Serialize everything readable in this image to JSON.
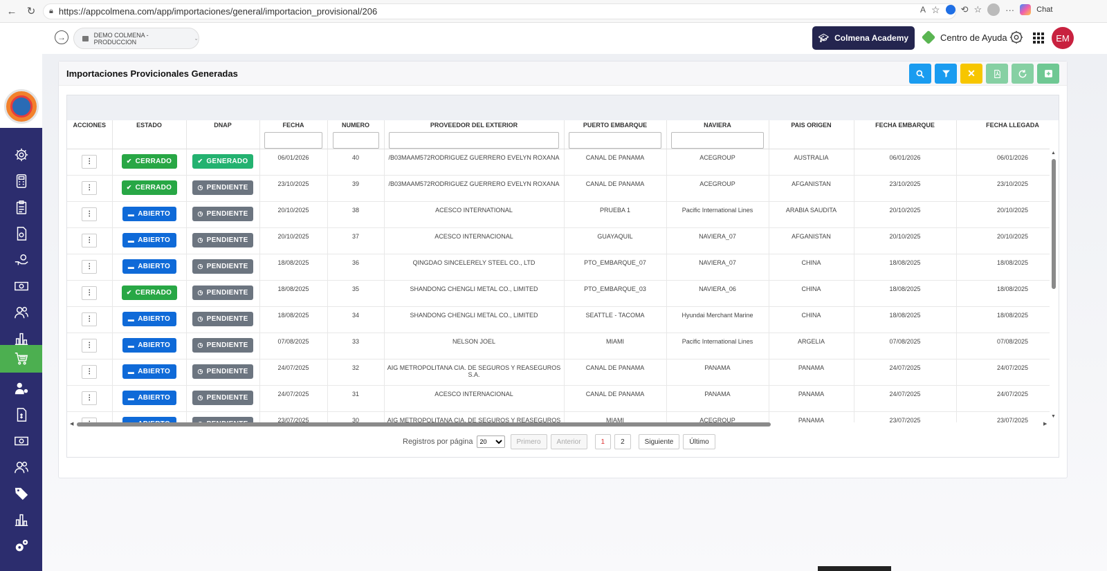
{
  "browser": {
    "url": "https://appcolmena.com/app/importaciones/general/importacion_provisional/206",
    "chat_label": "Chat"
  },
  "appbar": {
    "environment": "DEMO COLMENA - PRODUCCION",
    "academy_label": "Colmena Academy",
    "help_label": "Centro de Ayuda",
    "avatar_initials": "EM"
  },
  "sidebar": {
    "items": [
      {
        "icon": "gear-icon"
      },
      {
        "icon": "calculator-icon"
      },
      {
        "icon": "clipboard-icon"
      },
      {
        "icon": "invoice-icon"
      },
      {
        "icon": "hand-money-icon"
      },
      {
        "icon": "cash-icon"
      },
      {
        "icon": "users-icon"
      },
      {
        "icon": "bar-chart-icon"
      },
      {
        "icon": "cart-icon",
        "active": true
      },
      {
        "icon": "user-money-icon"
      },
      {
        "icon": "invoice-dollar-icon"
      },
      {
        "icon": "cash-icon"
      },
      {
        "icon": "users-icon"
      },
      {
        "icon": "tags-icon"
      },
      {
        "icon": "bar-chart-icon"
      },
      {
        "icon": "gears-icon"
      }
    ]
  },
  "card": {
    "title": "Importaciones Provicionales Generadas",
    "tools": [
      {
        "icon": "search-icon",
        "color": "#1a9cf0"
      },
      {
        "icon": "filter-icon",
        "color": "#1a9cf0"
      },
      {
        "icon": "clear-icon",
        "color": "#f7c600"
      },
      {
        "icon": "pdf-icon",
        "color": "#86d0a3"
      },
      {
        "icon": "refresh-icon",
        "color": "#86d0a3"
      },
      {
        "icon": "add-icon",
        "color": "#6fc893"
      }
    ]
  },
  "table": {
    "columns": [
      "ACCIONES",
      "ESTADO",
      "DNAP",
      "FECHA",
      "NUMERO",
      "PROVEEDOR DEL EXTERIOR",
      "PUERTO EMBARQUE",
      "NAVIERA",
      "PAIS ORIGEN",
      "FECHA EMBARQUE",
      "FECHA LLEGADA"
    ],
    "action_label": "⋮",
    "rows": [
      {
        "estado": "CERRADO",
        "dnap": "GENERADO",
        "fecha": "06/01/2026",
        "numero": "40",
        "proveedor": "/B03MAAM572RODRIGUEZ GUERRERO EVELYN ROXANA",
        "puerto": "CANAL DE PANAMA",
        "naviera": "ACEGROUP",
        "pais": "AUSTRALIA",
        "fecha_embarque": "06/01/2026",
        "fecha_llegada": "06/01/2026"
      },
      {
        "estado": "CERRADO",
        "dnap": "PENDIENTE",
        "fecha": "23/10/2025",
        "numero": "39",
        "proveedor": "/B03MAAM572RODRIGUEZ GUERRERO EVELYN ROXANA",
        "puerto": "CANAL DE PANAMA",
        "naviera": "ACEGROUP",
        "pais": "AFGANISTAN",
        "fecha_embarque": "23/10/2025",
        "fecha_llegada": "23/10/2025"
      },
      {
        "estado": "ABIERTO",
        "dnap": "PENDIENTE",
        "fecha": "20/10/2025",
        "numero": "38",
        "proveedor": "ACESCO INTERNATIONAL",
        "puerto": "PRUEBA 1",
        "naviera": "Pacific International Lines",
        "pais": "ARABIA SAUDITA",
        "fecha_embarque": "20/10/2025",
        "fecha_llegada": "20/10/2025"
      },
      {
        "estado": "ABIERTO",
        "dnap": "PENDIENTE",
        "fecha": "20/10/2025",
        "numero": "37",
        "proveedor": "ACESCO INTERNACIONAL",
        "puerto": "GUAYAQUIL",
        "naviera": "NAVIERA_07",
        "pais": "AFGANISTAN",
        "fecha_embarque": "20/10/2025",
        "fecha_llegada": "20/10/2025"
      },
      {
        "estado": "ABIERTO",
        "dnap": "PENDIENTE",
        "fecha": "18/08/2025",
        "numero": "36",
        "proveedor": "QINGDAO SINCELERELY STEEL CO., LTD",
        "puerto": "PTO_EMBARQUE_07",
        "naviera": "NAVIERA_07",
        "pais": "CHINA",
        "fecha_embarque": "18/08/2025",
        "fecha_llegada": "18/08/2025"
      },
      {
        "estado": "CERRADO",
        "dnap": "PENDIENTE",
        "fecha": "18/08/2025",
        "numero": "35",
        "proveedor": "SHANDONG CHENGLI METAL CO., LIMITED",
        "puerto": "PTO_EMBARQUE_03",
        "naviera": "NAVIERA_06",
        "pais": "CHINA",
        "fecha_embarque": "18/08/2025",
        "fecha_llegada": "18/08/2025"
      },
      {
        "estado": "ABIERTO",
        "dnap": "PENDIENTE",
        "fecha": "18/08/2025",
        "numero": "34",
        "proveedor": "SHANDONG CHENGLI METAL CO., LIMITED",
        "puerto": "SEATTLE - TACOMA",
        "naviera": "Hyundai Merchant Marine",
        "pais": "CHINA",
        "fecha_embarque": "18/08/2025",
        "fecha_llegada": "18/08/2025"
      },
      {
        "estado": "ABIERTO",
        "dnap": "PENDIENTE",
        "fecha": "07/08/2025",
        "numero": "33",
        "proveedor": "NELSON JOEL",
        "puerto": "MIAMI",
        "naviera": "Pacific International Lines",
        "pais": "ARGELIA",
        "fecha_embarque": "07/08/2025",
        "fecha_llegada": "07/08/2025"
      },
      {
        "estado": "ABIERTO",
        "dnap": "PENDIENTE",
        "fecha": "24/07/2025",
        "numero": "32",
        "proveedor": "AIG METROPOLITANA CIA. DE SEGUROS Y REASEGUROS S.A.",
        "puerto": "CANAL DE PANAMA",
        "naviera": "PANAMA",
        "pais": "PANAMA",
        "fecha_embarque": "24/07/2025",
        "fecha_llegada": "24/07/2025"
      },
      {
        "estado": "ABIERTO",
        "dnap": "PENDIENTE",
        "fecha": "24/07/2025",
        "numero": "31",
        "proveedor": "ACESCO INTERNACIONAL",
        "puerto": "CANAL DE PANAMA",
        "naviera": "PANAMA",
        "pais": "PANAMA",
        "fecha_embarque": "24/07/2025",
        "fecha_llegada": "24/07/2025"
      },
      {
        "estado": "ABIERTO",
        "dnap": "PENDIENTE",
        "fecha": "23/07/2025",
        "numero": "30",
        "proveedor": "AIG METROPOLITANA CIA. DE SEGUROS Y REASEGUROS S.A.",
        "puerto": "MIAMI",
        "naviera": "ACEGROUP",
        "pais": "PANAMA",
        "fecha_embarque": "23/07/2025",
        "fecha_llegada": "23/07/2025"
      }
    ]
  },
  "pager": {
    "label": "Registros por página",
    "page_size": "20",
    "first": "Primero",
    "prev": "Anterior",
    "pages": [
      "1",
      "2"
    ],
    "current_page": "1",
    "next": "Siguiente",
    "last": "Último"
  },
  "colors": {
    "sidebar_bg": "#2c2d6e",
    "active_item": "#4caf50",
    "abierto": "#0f6ad8",
    "cerrado": "#28a745",
    "generado": "#23b270",
    "pendiente": "#6c7580"
  }
}
